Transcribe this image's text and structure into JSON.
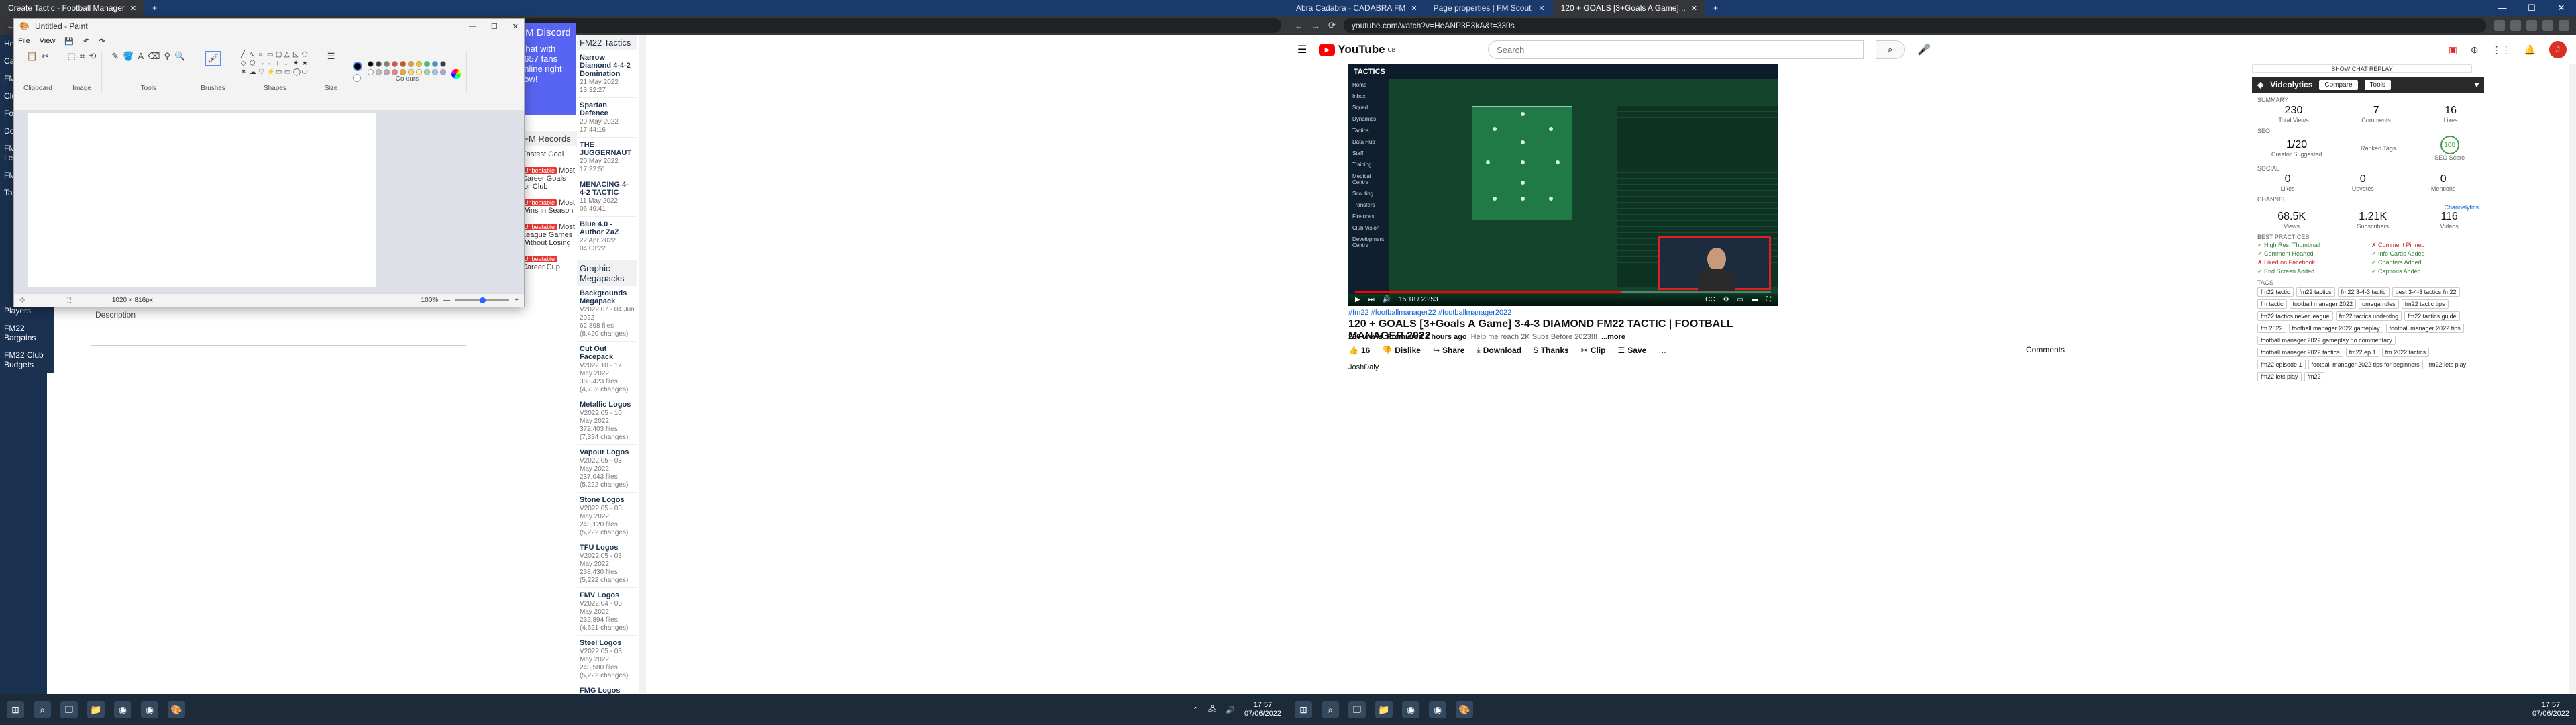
{
  "left": {
    "tabs": [
      {
        "label": "Create Tactic - Football Manager"
      },
      {
        "label": "FM22 Discord"
      }
    ],
    "sidebar": [
      "Home",
      "Career",
      "FM22",
      "Club",
      "Forum",
      "Downloads",
      "FM22 League",
      "FM22 Fix",
      "Tactics"
    ],
    "discord": {
      "title": "FM Discord",
      "text": "Chat with 1657 fans online right now!"
    },
    "tactics_col": {
      "header": "FM22 Tactics",
      "items": [
        {
          "title": "Narrow Diamond 4-4-2 Domination",
          "date": "21 May 2022 13:32:27"
        },
        {
          "title": "Spartan Defence",
          "date": "20 May 2022 17:44:16"
        },
        {
          "title": "THE JUGGERNAUT",
          "date": "20 May 2022 17:22:51"
        },
        {
          "title": "MENACING 4-4-2 TACTIC",
          "date": "11 May 2022 06:49:41"
        },
        {
          "title": "Blue 4.0 - Author ZaZ",
          "date": "22 Apr 2022 04:03:22"
        }
      ],
      "graphics_header": "Graphic Megapacks",
      "graphics": [
        {
          "title": "Backgrounds Megapack",
          "ver": "V2022.07 - 04 Jun 2022",
          "files": "62,898 files (8,420 changes)"
        },
        {
          "title": "Cut Out Facepack",
          "ver": "V2022.10 - 17 May 2022",
          "files": "368,423 files (4,732 changes)"
        },
        {
          "title": "Metallic Logos",
          "ver": "V2022.05 - 10 May 2022",
          "files": "372,403 files (7,334 changes)"
        },
        {
          "title": "Vapour Logos",
          "ver": "V2022.05 - 03 May 2022",
          "files": "237,043 files (5,222 changes)"
        },
        {
          "title": "Stone Logos",
          "ver": "V2022.05 - 03 May 2022",
          "files": "248,120 files (5,222 changes)"
        },
        {
          "title": "TFU Logos",
          "ver": "V2022.05 - 03 May 2022",
          "files": "238,430 files (5,222 changes)"
        },
        {
          "title": "FMV Logos",
          "ver": "V2022.04 - 03 May 2022",
          "files": "232,894 files (4,621 changes)"
        },
        {
          "title": "Steel Logos",
          "ver": "V2022.05 - 03 May 2022",
          "files": "248,580 files (5,222 changes)"
        },
        {
          "title": "FMG Logos",
          "ver": "V2022.05 - 03 May 2022",
          "files": "224,042 files (5,222 changes)"
        }
      ]
    },
    "records": {
      "header": "FM Records",
      "rows": [
        "Fastest Goal",
        "Most Career Goals for Club",
        "Most Wins in Season",
        "Most League Games Without Losing",
        "Career Cup"
      ],
      "badge": "Unbeatable"
    },
    "left_list": [
      "Players",
      "FM22 Bargains",
      "FM22 Club Budgets"
    ],
    "description_label": "Description",
    "paint": {
      "title": "Untitled - Paint",
      "menu": [
        "File",
        "View"
      ],
      "groups": [
        "Clipboard",
        "Image",
        "Tools",
        "Brushes",
        "Shapes",
        "Size",
        "Colours"
      ],
      "status_size": "1020 × 816px",
      "zoom": "100%",
      "colors": [
        "#000000",
        "#3b3b3b",
        "#7f7f7f",
        "#e74c3c",
        "#d35400",
        "#f39c12",
        "#f1c40f",
        "#2ecc71",
        "#3498db",
        "#2c3e50",
        "#ffffff",
        "#c0c0c0",
        "#b0b0b0",
        "#f08080",
        "#f5a623",
        "#ffd966",
        "#fff59d",
        "#a5d6a7",
        "#90caf9",
        "#b39ddb"
      ]
    },
    "taskbar": {
      "time": "17:57",
      "date": "07/06/2022"
    }
  },
  "right": {
    "tabs": [
      {
        "label": "Abra Cadabra - CADABRA FM"
      },
      {
        "label": "Page properties | FM Scout"
      },
      {
        "label": "120 + GOALS [3+Goals A Game]..."
      }
    ],
    "url": "youtube.com/watch?v=HeANP3E3kA&t=330s",
    "search_placeholder": "Search",
    "logo_text": "YouTube",
    "logo_region": "GB",
    "avatar": "J",
    "player": {
      "tactics_title": "TACTICS",
      "time": "15:18 / 23:53",
      "progress": 0.64,
      "nav": [
        "Home",
        "Inbox",
        "Squad",
        "Dynamics",
        "Tactics",
        "Data Hub",
        "Staff",
        "Training",
        "Medical Centre",
        "Scouting",
        "Transfers",
        "Finances",
        "Club Vision",
        "Development Centre"
      ]
    },
    "video": {
      "tags_line": "#fm22 #footballmanager22 #footballmanager2022",
      "title": "120 + GOALS [3+Goals A Game] 3-4-3 DIAMOND FM22 TACTIC | FOOTBALL MANAGER 2022",
      "views": "230 views",
      "premiered": "Premiered 4 hours ago",
      "subs_help": "Help me reach 2K Subs Before 2023!!!",
      "more": "...more",
      "likes": "16",
      "actions": [
        "Dislike",
        "Share",
        "Download",
        "Thanks",
        "Clip",
        "Save"
      ],
      "channel": "JoshDaly",
      "comments_label": "Comments"
    },
    "live_chat": "SHOW CHAT REPLAY",
    "videolytics": {
      "title": "Videolytics",
      "compare": "Compare",
      "tools": "Tools",
      "summary_label": "SUMMARY",
      "stats": [
        {
          "n": "230",
          "l": "Total Views"
        },
        {
          "n": "7",
          "l": "Comments"
        },
        {
          "n": "16",
          "l": "Likes"
        }
      ],
      "seo_label": "SEO",
      "seo": [
        {
          "n": "1/20",
          "l": "Creator Suggested"
        },
        {
          "n": "",
          "l": "Ranked Tags"
        },
        {
          "n": "100",
          "l": "SEO Score"
        }
      ],
      "social_label": "SOCIAL",
      "social": [
        {
          "n": "0",
          "l": "Likes"
        },
        {
          "n": "0",
          "l": "Upvotes"
        },
        {
          "n": "0",
          "l": "Mentions"
        }
      ],
      "channel_label": "CHANNEL",
      "channel_link": "Channelytics",
      "channel": [
        {
          "n": "68.5K",
          "l": "Views"
        },
        {
          "n": "1.21K",
          "l": "Subscribers"
        },
        {
          "n": "116",
          "l": "Videos"
        }
      ],
      "bp_label": "BEST PRACTICES",
      "bp": [
        {
          "t": "High Res. Thumbnail",
          "ok": true
        },
        {
          "t": "Comment Pinned",
          "ok": false
        },
        {
          "t": "Comment Hearted",
          "ok": true
        },
        {
          "t": "Info Cards Added",
          "ok": true
        },
        {
          "t": "Liked on Facebook",
          "ok": false
        },
        {
          "t": "Chapters Added",
          "ok": true
        },
        {
          "t": "End Screen Added",
          "ok": true
        },
        {
          "t": "Captions Added",
          "ok": true
        }
      ],
      "tags_label": "TAGS",
      "tags": [
        "fm22 tactic",
        "fm22 tactics",
        "fm22 3-4-3 tactic",
        "best 3-4-3 tactics fm22",
        "fm tactic",
        "football manager 2022",
        "omega rules",
        "fm22 tactic tips",
        "fm22 tactics never league",
        "fm22 tactics underdog",
        "fm22 tactics guide",
        "fm 2022",
        "football manager 2022 gameplay",
        "football manager 2022 tips",
        "football manager 2022 gameplay no commentary",
        "football manager 2022 tactics",
        "fm22 ep 1",
        "fm 2022 tactics",
        "fm22 episode 1",
        "football manager 2022 tips for beginners",
        "fm22 lets play",
        "fm22 lets play",
        "fm22"
      ]
    },
    "taskbar": {
      "time": "17:57",
      "date": "07/06/2022"
    }
  }
}
